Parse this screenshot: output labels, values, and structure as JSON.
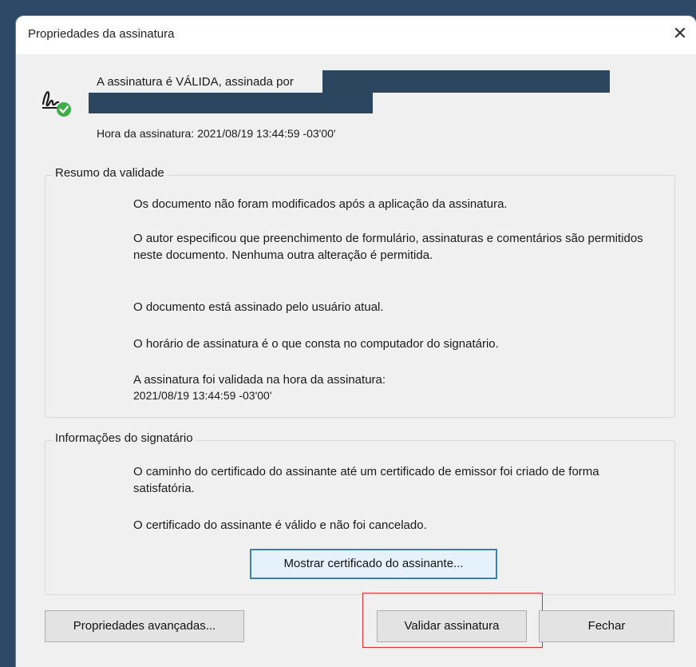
{
  "window": {
    "title": "Propriedades da assinatura",
    "close_symbol": "✕"
  },
  "signature": {
    "status_text": "A assinatura é VÁLIDA, assinada por",
    "time_label": "Hora da assinatura:",
    "time_value": "2021/08/19 13:44:59 -03'00'"
  },
  "validity_summary": {
    "title": "Resumo da validade",
    "lines": [
      "Os documento não foram modificados após a aplicação da assinatura.",
      "O autor especificou que preenchimento de formulário, assinaturas e comentários são permitidos neste documento. Nenhuma outra alteração é permitida.",
      "O documento está assinado pelo usuário atual.",
      "O horário de assinatura é o que consta no computador do signatário.",
      "A assinatura foi validada na hora da assinatura:",
      "2021/08/19 13:44:59 -03'00'"
    ]
  },
  "signer_info": {
    "title": "Informações do signatário",
    "lines": [
      "O caminho do certificado do assinante até um certificado de emissor foi criado de forma satisfatória.",
      "O certificado do assinante é válido e não foi cancelado."
    ],
    "show_cert_label": "Mostrar certificado do assinante..."
  },
  "footer": {
    "advanced_label": "Propriedades avançadas...",
    "validate_label": "Validar assinatura",
    "close_label": "Fechar"
  },
  "colors": {
    "redaction": "#2c4660",
    "highlight_border": "#d43030",
    "focus_border": "#3c7fb1",
    "valid_check": "#3fae49"
  }
}
